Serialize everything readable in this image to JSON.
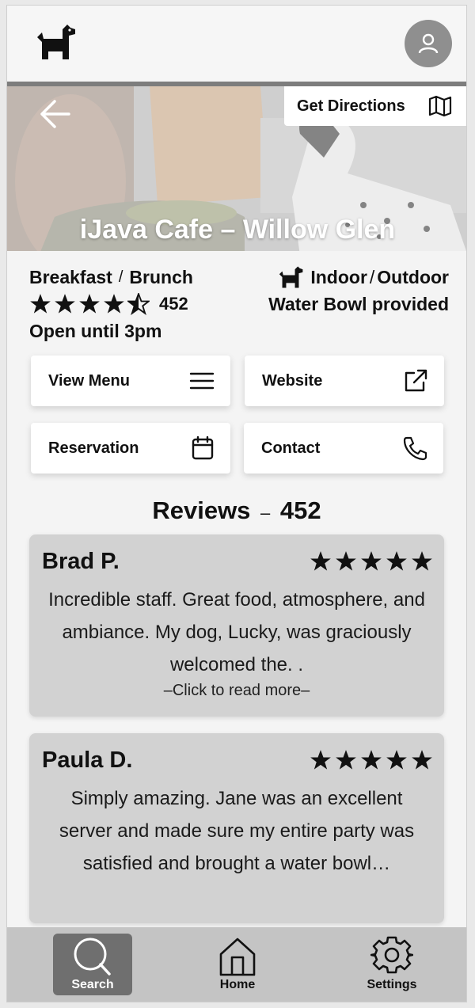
{
  "header": {
    "logo_icon": "dog-icon",
    "profile_icon": "user-icon"
  },
  "hero": {
    "title": "iJava Cafe – Willow Glen",
    "directions_label": "Get Directions",
    "back_icon": "arrow-left-icon",
    "map_icon": "map-icon"
  },
  "details": {
    "category_1": "Breakfast",
    "category_sep": "/",
    "category_2": "Brunch",
    "rating": 4.5,
    "rating_count": "452",
    "hours": "Open until 3pm",
    "seating_1": "Indoor",
    "seating_sep": "/",
    "seating_2": "Outdoor",
    "amenity": "Water Bowl provided"
  },
  "actions": {
    "menu": "View Menu",
    "website": "Website",
    "reservation": "Reservation",
    "contact": "Contact"
  },
  "reviews": {
    "heading": "Reviews",
    "dash": "–",
    "count": "452",
    "items": [
      {
        "name": "Brad P.",
        "stars": 5,
        "text": "Incredible staff. Great food, atmosphere, and ambiance. My dog, Lucky, was graciously welcomed the. .",
        "more": "–Click to read more–"
      },
      {
        "name": "Paula D.",
        "stars": 5,
        "text": "Simply amazing. Jane was an excellent server and made sure my entire party was satisfied and brought a water bowl…"
      }
    ]
  },
  "nav": {
    "search": "Search",
    "home": "Home",
    "settings": "Settings",
    "active": "search"
  },
  "colors": {
    "background": "#f4f4f4",
    "review_card": "#d2d2d2",
    "nav_bar": "#c4c4c4",
    "nav_active": "#6f6f6f",
    "avatar": "#8f8f8f"
  }
}
